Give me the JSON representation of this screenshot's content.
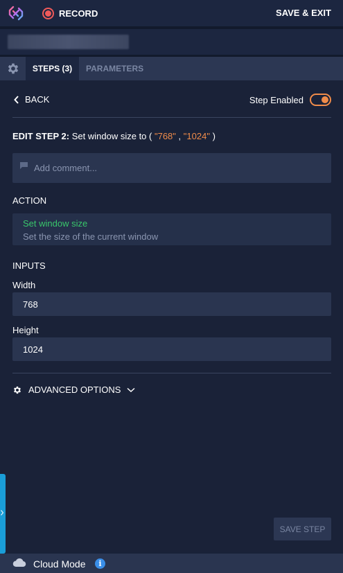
{
  "topbar": {
    "record_label": "RECORD",
    "save_exit_label": "SAVE & EXIT"
  },
  "tabs": {
    "steps_label": "STEPS (3)",
    "parameters_label": "PARAMETERS"
  },
  "step": {
    "back_label": "BACK",
    "enabled_label": "Step Enabled",
    "enabled": true,
    "edit_prefix": "EDIT STEP 2:",
    "edit_text": "Set window size to (",
    "arg1": "\"768\"",
    "arg_sep": ",",
    "arg2": "\"1024\"",
    "edit_close": ")",
    "comment_placeholder": "Add comment..."
  },
  "action": {
    "section_label": "ACTION",
    "name": "Set window size",
    "description": "Set the size of the current window"
  },
  "inputs": {
    "section_label": "INPUTS",
    "width_label": "Width",
    "width_value": "768",
    "height_label": "Height",
    "height_value": "1024"
  },
  "advanced_label": "ADVANCED OPTIONS",
  "save_step_label": "SAVE STEP",
  "footer": {
    "cloud_label": "Cloud Mode",
    "info_glyph": "i"
  },
  "icons": {
    "logo": "app-logo-icon",
    "settings": "gear-icon",
    "back": "chevron-left-icon",
    "comment": "comment-icon",
    "advanced": "gear-icon",
    "expand": "chevron-down-icon",
    "cloud": "cloud-icon",
    "info": "info-icon"
  },
  "colors": {
    "accent_orange": "#f08c4a",
    "action_green": "#39c66b",
    "record_red": "#f05a5a",
    "info_blue": "#3a8ee8",
    "side_tab_blue": "#1a9ed8"
  }
}
